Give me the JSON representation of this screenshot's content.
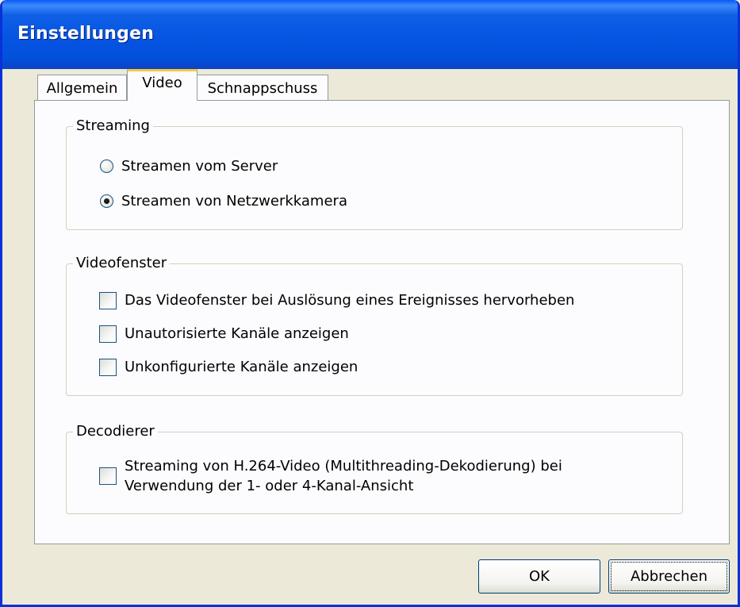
{
  "window": {
    "title": "Einstellungen"
  },
  "tabs": [
    {
      "label": "Allgemein",
      "active": false
    },
    {
      "label": "Video",
      "active": true
    },
    {
      "label": "Schnappschuss",
      "active": false
    }
  ],
  "streaming": {
    "legend": "Streaming",
    "options": [
      {
        "label": "Streamen vom Server",
        "selected": false
      },
      {
        "label": "Streamen von Netzwerkkamera",
        "selected": true
      }
    ]
  },
  "videofenster": {
    "legend": "Videofenster",
    "options": [
      {
        "label": "Das Videofenster bei Auslösung eines Ereignisses hervorheben",
        "checked": false
      },
      {
        "label": "Unautorisierte Kanäle anzeigen",
        "checked": false
      },
      {
        "label": "Unkonfigurierte Kanäle anzeigen",
        "checked": false
      }
    ]
  },
  "decodierer": {
    "legend": "Decodierer",
    "option": {
      "label": "Streaming von H.264-Video (Multithreading-Dekodierung) bei Verwendung der 1- oder 4-Kanal-Ansicht",
      "checked": false
    }
  },
  "buttons": {
    "ok_label": "OK",
    "cancel_label": "Abbrechen"
  },
  "colors": {
    "titlebar": "#0654e2",
    "dialog_bg": "#ece9d8",
    "tab_accent": "#ffc83c"
  }
}
